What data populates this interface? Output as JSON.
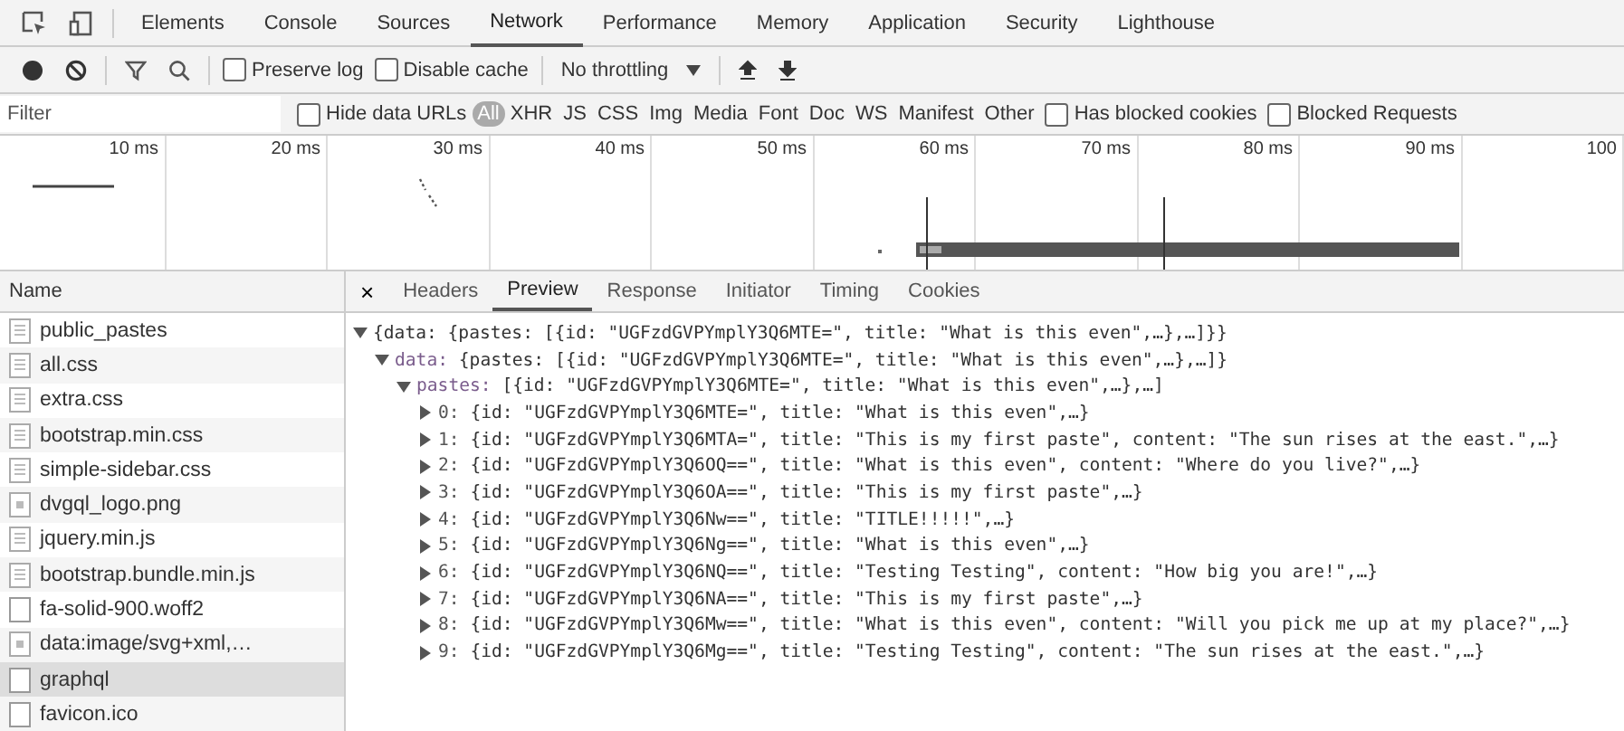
{
  "panel_tabs": [
    {
      "label": "Elements",
      "selected": false
    },
    {
      "label": "Console",
      "selected": false
    },
    {
      "label": "Sources",
      "selected": false
    },
    {
      "label": "Network",
      "selected": true
    },
    {
      "label": "Performance",
      "selected": false
    },
    {
      "label": "Memory",
      "selected": false
    },
    {
      "label": "Application",
      "selected": false
    },
    {
      "label": "Security",
      "selected": false
    },
    {
      "label": "Lighthouse",
      "selected": false
    }
  ],
  "toolbar": {
    "recording": true,
    "checkboxes": [
      {
        "label": "Preserve log",
        "checked": false
      },
      {
        "label": "Disable cache",
        "checked": false
      }
    ],
    "throttling": "No throttling"
  },
  "filter": {
    "placeholder": "Filter",
    "hide_data_urls": {
      "label": "Hide data URLs",
      "checked": false
    },
    "types": [
      {
        "label": "All",
        "selected": true
      },
      {
        "label": "XHR",
        "selected": false
      },
      {
        "label": "JS",
        "selected": false
      },
      {
        "label": "CSS",
        "selected": false
      },
      {
        "label": "Img",
        "selected": false
      },
      {
        "label": "Media",
        "selected": false
      },
      {
        "label": "Font",
        "selected": false
      },
      {
        "label": "Doc",
        "selected": false
      },
      {
        "label": "WS",
        "selected": false
      },
      {
        "label": "Manifest",
        "selected": false
      },
      {
        "label": "Other",
        "selected": false
      }
    ],
    "extra_checkboxes": [
      {
        "label": "Has blocked cookies",
        "checked": false
      },
      {
        "label": "Blocked Requests",
        "checked": false
      }
    ]
  },
  "timeline": {
    "ticks": [
      "10 ms",
      "20 ms",
      "30 ms",
      "40 ms",
      "50 ms",
      "60 ms",
      "70 ms",
      "80 ms",
      "90 ms",
      "100"
    ]
  },
  "requests": {
    "column": "Name",
    "rows": [
      {
        "name": "public_pastes",
        "kind": "document",
        "selected": false
      },
      {
        "name": "all.css",
        "kind": "document",
        "selected": false
      },
      {
        "name": "extra.css",
        "kind": "document",
        "selected": false
      },
      {
        "name": "bootstrap.min.css",
        "kind": "document",
        "selected": false
      },
      {
        "name": "simple-sidebar.css",
        "kind": "document",
        "selected": false
      },
      {
        "name": "dvgql_logo.png",
        "kind": "image",
        "selected": false
      },
      {
        "name": "jquery.min.js",
        "kind": "document",
        "selected": false
      },
      {
        "name": "bootstrap.bundle.min.js",
        "kind": "document",
        "selected": false
      },
      {
        "name": "fa-solid-900.woff2",
        "kind": "blank",
        "selected": false
      },
      {
        "name": "data:image/svg+xml,…",
        "kind": "image",
        "selected": false
      },
      {
        "name": "graphql",
        "kind": "blank",
        "selected": true
      },
      {
        "name": "favicon.ico",
        "kind": "blank",
        "selected": false
      }
    ]
  },
  "detail_tabs": {
    "close": "×",
    "tabs": [
      {
        "label": "Headers",
        "selected": false
      },
      {
        "label": "Preview",
        "selected": true
      },
      {
        "label": "Response",
        "selected": false
      },
      {
        "label": "Initiator",
        "selected": false
      },
      {
        "label": "Timing",
        "selected": false
      },
      {
        "label": "Cookies",
        "selected": false
      }
    ]
  },
  "preview": {
    "expanded": true,
    "text": "{data: {pastes: [{id: \"UGFzdGVPYmplY3Q6MTE=\", title: \"What is this even\",…},…]}}",
    "children": [
      {
        "key": "data:",
        "expanded": true,
        "text": "{pastes: [{id: \"UGFzdGVPYmplY3Q6MTE=\", title: \"What is this even\",…},…]}",
        "children": [
          {
            "key": "pastes:",
            "expanded": true,
            "text": "[{id: \"UGFzdGVPYmplY3Q6MTE=\", title: \"What is this even\",…},…]",
            "children": [
              {
                "key": "0:",
                "expanded": false,
                "text": "{id: \"UGFzdGVPYmplY3Q6MTE=\", title: \"What is this even\",…}"
              },
              {
                "key": "1:",
                "expanded": false,
                "text": "{id: \"UGFzdGVPYmplY3Q6MTA=\", title: \"This is my first paste\", content: \"The sun rises at the east.\",…}"
              },
              {
                "key": "2:",
                "expanded": false,
                "text": "{id: \"UGFzdGVPYmplY3Q6OQ==\", title: \"What is this even\", content: \"Where do you live?\",…}"
              },
              {
                "key": "3:",
                "expanded": false,
                "text": "{id: \"UGFzdGVPYmplY3Q6OA==\", title: \"This is my first paste\",…}"
              },
              {
                "key": "4:",
                "expanded": false,
                "text": "{id: \"UGFzdGVPYmplY3Q6Nw==\", title: \"TITLE!!!!!\",…}"
              },
              {
                "key": "5:",
                "expanded": false,
                "text": "{id: \"UGFzdGVPYmplY3Q6Ng==\", title: \"What is this even\",…}"
              },
              {
                "key": "6:",
                "expanded": false,
                "text": "{id: \"UGFzdGVPYmplY3Q6NQ==\", title: \"Testing Testing\", content: \"How big you are!\",…}"
              },
              {
                "key": "7:",
                "expanded": false,
                "text": "{id: \"UGFzdGVPYmplY3Q6NA==\", title: \"This is my first paste\",…}"
              },
              {
                "key": "8:",
                "expanded": false,
                "text": "{id: \"UGFzdGVPYmplY3Q6Mw==\", title: \"What is this even\", content: \"Will you pick me up at my place?\",…}"
              },
              {
                "key": "9:",
                "expanded": false,
                "text": "{id: \"UGFzdGVPYmplY3Q6Mg==\", title: \"Testing Testing\", content: \"The sun rises at the east.\",…}"
              }
            ]
          }
        ]
      }
    ]
  }
}
